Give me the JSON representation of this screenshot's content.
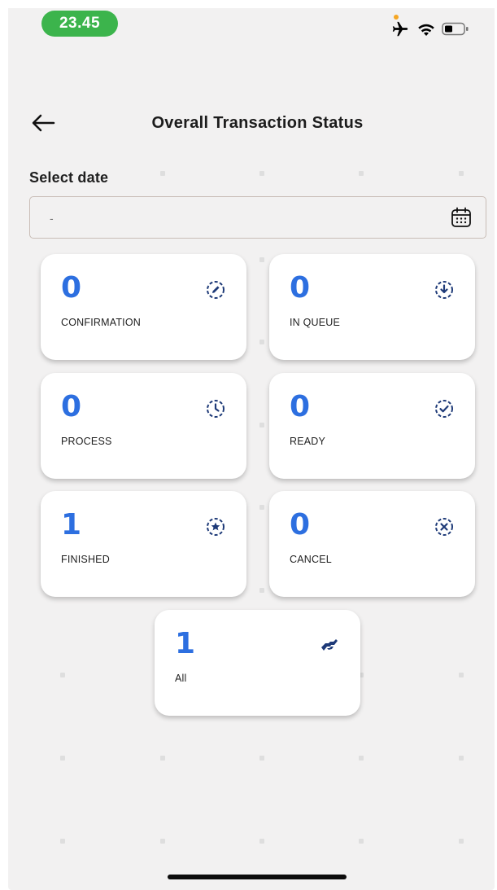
{
  "status_bar": {
    "time": "23.45",
    "icons": [
      "airplane-icon",
      "wifi-icon",
      "battery-icon"
    ]
  },
  "header": {
    "back_icon": "arrow-left-icon",
    "title": "Overall Transaction Status"
  },
  "date_filter": {
    "label": "Select date",
    "value": "-",
    "icon": "calendar-icon"
  },
  "cards": [
    {
      "count": "0",
      "label": "CONFIRMATION",
      "icon": "pencil-circle-icon"
    },
    {
      "count": "0",
      "label": "IN QUEUE",
      "icon": "download-circle-icon"
    },
    {
      "count": "0",
      "label": "PROCESS",
      "icon": "clock-circle-icon"
    },
    {
      "count": "0",
      "label": "READY",
      "icon": "check-circle-icon"
    },
    {
      "count": "1",
      "label": "FINISHED",
      "icon": "star-circle-icon"
    },
    {
      "count": "0",
      "label": "CANCEL",
      "icon": "x-circle-icon"
    },
    {
      "count": "1",
      "label": "All",
      "icon": "handshake-icon"
    }
  ],
  "colors": {
    "accent": "#2d6fe0",
    "icon_dark": "#1e3a78",
    "time_pill": "#3cb44c",
    "background": "#f2f1f1"
  }
}
